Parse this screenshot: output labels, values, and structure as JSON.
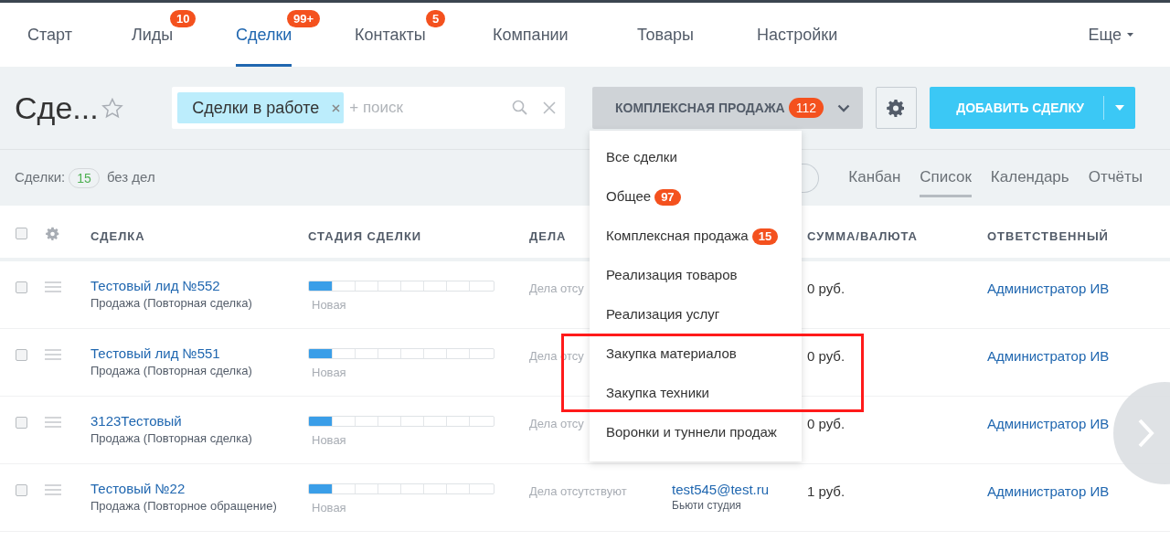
{
  "nav": {
    "items": [
      {
        "label": "Старт",
        "selected": false
      },
      {
        "label": "Лиды",
        "badge": "10",
        "selected": false
      },
      {
        "label": "Сделки",
        "badge": "99+",
        "selected": true
      },
      {
        "label": "Контакты",
        "badge": "5",
        "selected": false
      },
      {
        "label": "Компании",
        "selected": false
      },
      {
        "label": "Товары",
        "selected": false
      },
      {
        "label": "Настройки",
        "selected": false
      }
    ],
    "more": "Еще"
  },
  "toolbar": {
    "title": "Сде...",
    "filter_chip": "Сделки в работе",
    "search_placeholder": "+ поиск",
    "category_button": "КОМПЛЕКСНАЯ ПРОДАЖА",
    "category_badge": "112",
    "add_button": "ДОБАВИТЬ СДЕЛКУ"
  },
  "counters": {
    "label": "Сделки:",
    "count": "15",
    "suffix": "без дел"
  },
  "views": [
    {
      "label": "Канбан",
      "selected": false
    },
    {
      "label": "Список",
      "selected": true
    },
    {
      "label": "Календарь",
      "selected": false
    },
    {
      "label": "Отчёты",
      "selected": false
    }
  ],
  "table": {
    "all_checked": false,
    "columns": [
      "СДЕЛКА",
      "СТАДИЯ СДЕЛКИ",
      "ДЕЛА",
      "СУММА/ВАЛЮТА",
      "ОТВЕТСТВЕННЫЙ"
    ],
    "rows": [
      {
        "checked": false,
        "title": "Тестовый лид №552",
        "subtitle": "Продажа (Повторная сделка)",
        "stage": {
          "level": 0.125,
          "label": "Новая"
        },
        "activity": "Дела отсу",
        "sum": "0 руб.",
        "responsible": "Администратор ИВ"
      },
      {
        "checked": false,
        "title": "Тестовый лид №551",
        "subtitle": "Продажа (Повторная сделка)",
        "stage": {
          "level": 0.125,
          "label": "Новая"
        },
        "activity": "Дела отсу",
        "sum": "0 руб.",
        "responsible": "Администратор ИВ"
      },
      {
        "checked": false,
        "title": "3123Тестовый",
        "subtitle": "Продажа (Повторная сделка)",
        "stage": {
          "level": 0.125,
          "label": "Новая"
        },
        "activity": "Дела отсу",
        "sum": "0 руб.",
        "responsible": "Администратор ИВ"
      },
      {
        "checked": false,
        "title": "Тестовый №22",
        "subtitle": "Продажа (Повторное обращение)",
        "stage": {
          "level": 0.125,
          "label": "Новая"
        },
        "activity": "Дела отсутствуют",
        "contact": "test545@test.ru",
        "contact_sub": "Бьюти студия",
        "sum": "1 руб.",
        "responsible": "Администратор ИВ"
      }
    ]
  },
  "dropdown": {
    "items": [
      {
        "label": "Все сделки"
      },
      {
        "label": "Общее",
        "badge": "97"
      },
      {
        "label": "Комплексная продажа",
        "badge": "15"
      },
      {
        "label": "Реализация товаров"
      },
      {
        "label": "Реализация услуг"
      },
      {
        "label": "Закупка материалов"
      },
      {
        "label": "Закупка техники"
      },
      {
        "label": "Воронки и туннели продаж"
      }
    ]
  }
}
